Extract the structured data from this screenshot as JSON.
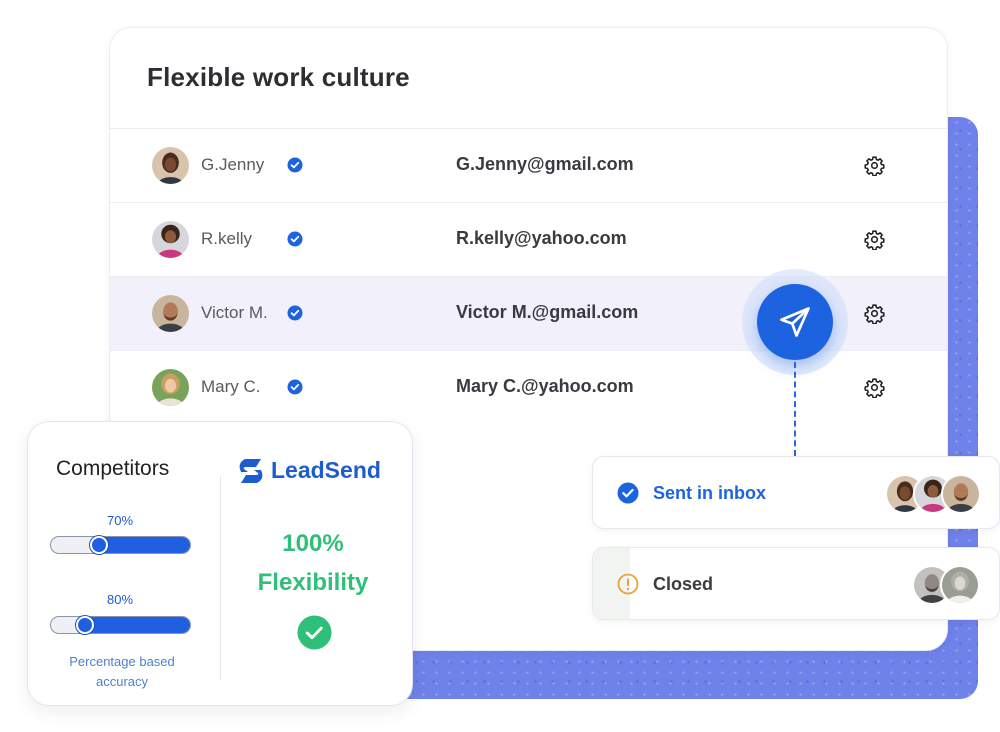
{
  "card": {
    "title": "Flexible work culture",
    "contacts": [
      {
        "name": "G.Jenny",
        "email": "G.Jenny@gmail.com",
        "verified": true,
        "highlighted": false
      },
      {
        "name": "R.kelly",
        "email": "R.kelly@yahoo.com",
        "verified": true,
        "highlighted": false
      },
      {
        "name": "Victor M.",
        "email": "Victor M.@gmail.com",
        "verified": true,
        "highlighted": true
      },
      {
        "name": "Mary C.",
        "email": "Mary C.@yahoo.com",
        "verified": true,
        "highlighted": false
      }
    ]
  },
  "icons": {
    "verified": "verified-check-icon",
    "settings": "gear-icon",
    "send": "paper-plane-icon",
    "sent": "check-circle-icon",
    "closed": "warning-circle-icon",
    "success": "check-badge-icon"
  },
  "status": {
    "sent_label": "Sent in inbox",
    "closed_label": "Closed"
  },
  "comparison": {
    "title": "Competitors",
    "bars": [
      {
        "label": "70%",
        "value": 0.7
      },
      {
        "label": "80%",
        "value": 0.8
      }
    ],
    "footnote_line1": "Percentage based",
    "footnote_line2": "accuracy",
    "brand": "LeadSend",
    "brand_value": "100%",
    "brand_metric": "Flexibility"
  },
  "colors": {
    "accent": "#1d63e0",
    "success": "#2fbf78",
    "warning": "#e6a23c",
    "backdrop": "#6f82ea",
    "highlight_row": "#f1f0fb"
  }
}
